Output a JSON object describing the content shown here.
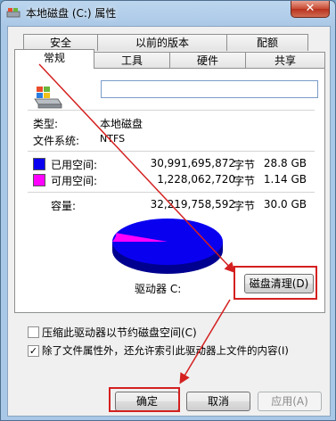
{
  "window": {
    "title": "本地磁盘 (C:) 属性",
    "close_symbol": "✕"
  },
  "tabs_row1": [
    {
      "label": "安全"
    },
    {
      "label": "以前的版本"
    },
    {
      "label": "配额"
    }
  ],
  "tabs_row2": [
    {
      "label": "常规"
    },
    {
      "label": "工具"
    },
    {
      "label": "硬件"
    },
    {
      "label": "共享"
    }
  ],
  "general": {
    "drive_name_value": "",
    "type_label": "类型:",
    "type_value": "本地磁盘",
    "fs_label": "文件系统:",
    "fs_value": "NTFS",
    "used": {
      "label": "已用空间:",
      "bytes": "30,991,695,872",
      "unit": "字节",
      "size": "28.8 GB",
      "color": "#0a00f0"
    },
    "free": {
      "label": "可用空间:",
      "bytes": "1,228,062,720",
      "unit": "字节",
      "size": "1.14 GB",
      "color": "#ff00ff"
    },
    "capacity": {
      "label": "容量:",
      "bytes": "32,219,758,592",
      "unit": "字节",
      "size": "30.0 GB"
    },
    "drive_caption": "驱动器 C:",
    "cleanup_button": "磁盘清理(D)",
    "pie": {
      "used_fraction": 0.962,
      "free_fraction": 0.038
    }
  },
  "options": {
    "compress_label": "压缩此驱动器以节约磁盘空间(C)",
    "compress_checked": false,
    "index_label": "除了文件属性外，还允许索引此驱动器上文件的内容(I)",
    "index_checked": true
  },
  "buttons": {
    "ok": "确定",
    "cancel": "取消",
    "apply": "应用(A)"
  },
  "annotation_color": "#d42020"
}
